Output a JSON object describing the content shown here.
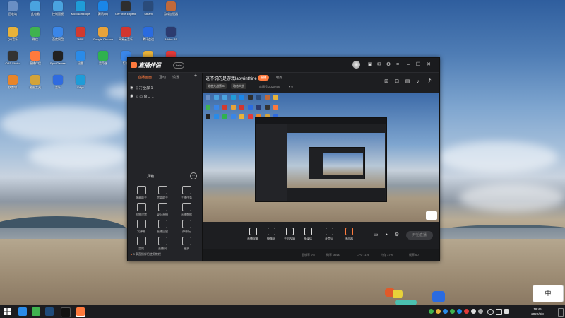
{
  "desktop_icons": [
    {
      "label": "回收站",
      "color": "#6a8fc4"
    },
    {
      "label": "此电脑",
      "color": "#4aa3df"
    },
    {
      "label": "控制面板",
      "color": "#4aa3df"
    },
    {
      "label": "Microsoft Edge",
      "color": "#1f9cd8"
    },
    {
      "label": "腾讯QQ",
      "color": "#1a86e8"
    },
    {
      "label": "GeForce Experience",
      "color": "#2e2e2e"
    },
    {
      "label": "Steam",
      "color": "#2a4b7a"
    },
    {
      "label": "游戏加速器",
      "color": "#c0693a"
    },
    {
      "label": "QQ音乐",
      "color": "#e8b23a"
    },
    {
      "label": "微信",
      "color": "#3fb24f"
    },
    {
      "label": "百度网盘",
      "color": "#3a86e8"
    },
    {
      "label": "WPS",
      "color": "#d23a2f"
    },
    {
      "label": "Google Chrome",
      "color": "#e8a33a"
    },
    {
      "label": "网易云音乐",
      "color": "#d2352f"
    },
    {
      "label": "腾讯会议",
      "color": "#2a6be0"
    },
    {
      "label": "Adobe PS",
      "color": "#2c3b6f"
    },
    {
      "label": "OBS Studio",
      "color": "#333333"
    },
    {
      "label": "直播伴侣",
      "color": "#ff7a3d"
    },
    {
      "label": "Epic Games",
      "color": "#222222"
    },
    {
      "label": "迅雷",
      "color": "#2a8be8"
    },
    {
      "label": "爱奇艺",
      "color": "#2fb24f"
    },
    {
      "label": "钉钉",
      "color": "#3a86e8"
    },
    {
      "label": "文件夹",
      "color": "#e8b23a"
    },
    {
      "label": "录屏",
      "color": "#e23a3a"
    },
    {
      "label": "快剪辑",
      "color": "#e8852a"
    },
    {
      "label": "截图工具",
      "color": "#d2a33a"
    },
    {
      "label": "音乐",
      "color": "#2f6be0"
    },
    {
      "label": "Edge",
      "color": "#1f9cd8"
    }
  ],
  "app": {
    "logo_text": "直播伴侣",
    "version_badge": "beta",
    "left_tabs": [
      "直播画面",
      "互动",
      "设置"
    ],
    "scenes": [
      {
        "name": "全屏 1"
      },
      {
        "name": "窗口 1"
      }
    ],
    "tools_title": "工具箱",
    "tools": [
      {
        "label": "弹幕助手"
      },
      {
        "label": "房管助手"
      },
      {
        "label": "主播任务"
      },
      {
        "label": "礼物设置"
      },
      {
        "label": "录入直播"
      },
      {
        "label": "直播数据"
      },
      {
        "label": "发弹幕"
      },
      {
        "label": "直播回放"
      },
      {
        "label": "弹幕板"
      },
      {
        "label": "音效"
      },
      {
        "label": "直播间"
      },
      {
        "label": "更多"
      }
    ],
    "bottom_hint": "3 条直播伴侣使用教程",
    "room_title": "这不说的是游戏labyrinthine",
    "live_pill": "直播",
    "pill_text": "取消",
    "tags": [
      "暗恋大战第二",
      "暗恋大战"
    ],
    "meta_id": "房间号 2020758",
    "meta_likes": "0",
    "bottom_buttons": [
      {
        "label": "直播屏幕"
      },
      {
        "label": "摄像头"
      },
      {
        "label": "手机投屏"
      },
      {
        "label": "多媒体"
      },
      {
        "label": "麦克风"
      },
      {
        "label": "扬声器"
      }
    ],
    "start_live": "开始直播",
    "status": [
      {
        "text": "丢帧率 0%"
      },
      {
        "text": "码率 0kb/s"
      },
      {
        "text": "CPU 11%"
      },
      {
        "text": "内存 37%"
      },
      {
        "text": "帧率 60"
      }
    ]
  },
  "taskbar": {
    "time": "19:46",
    "date": "2022/8/8",
    "ime": "中"
  }
}
